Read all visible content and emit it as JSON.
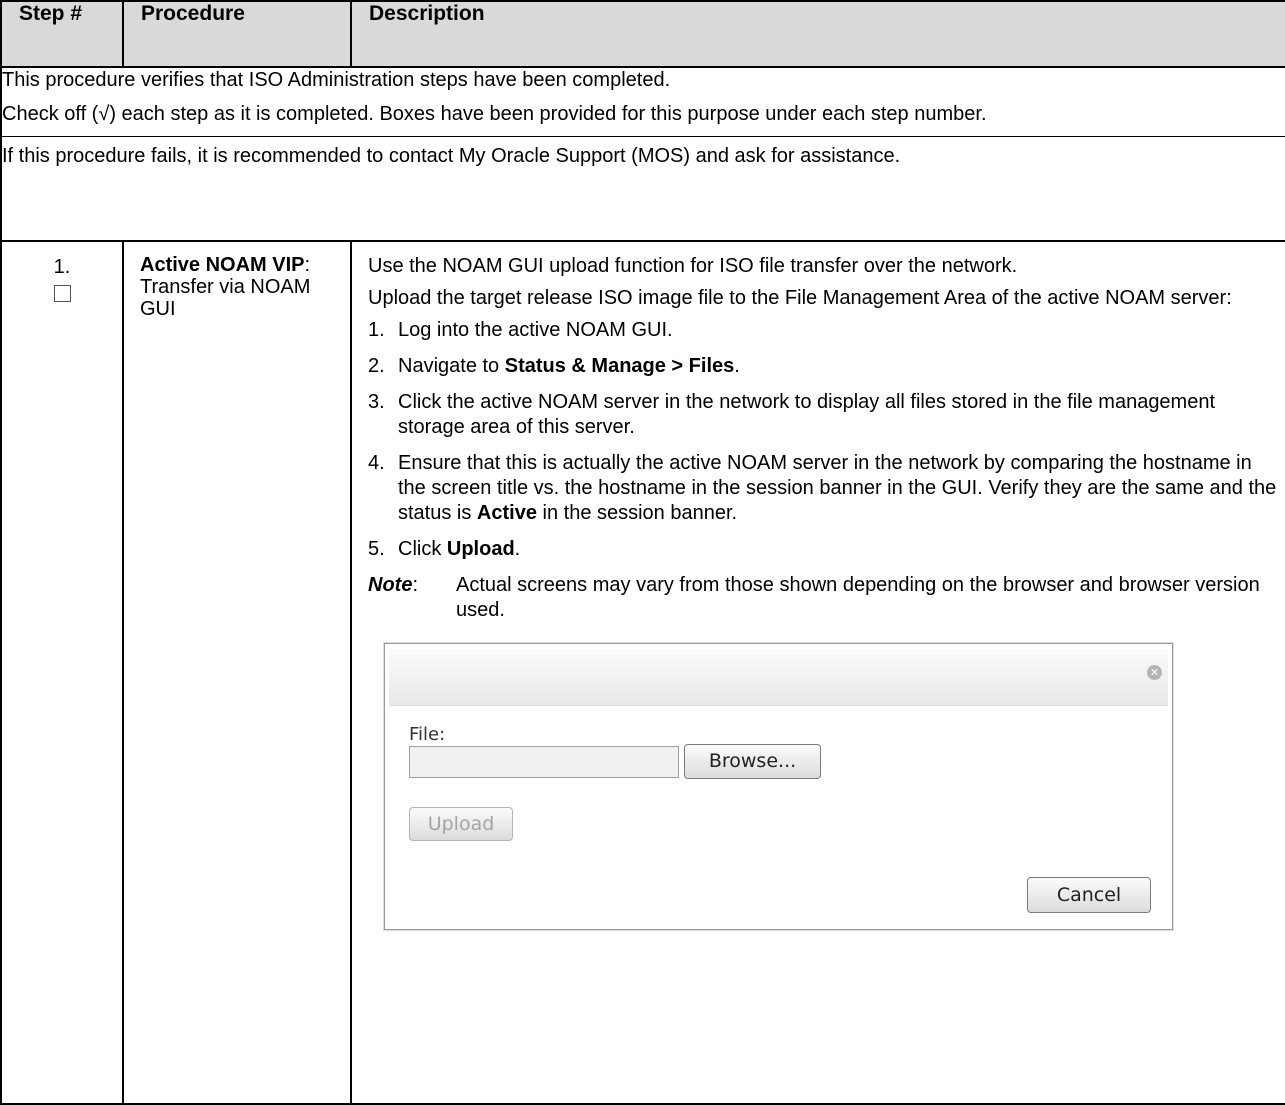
{
  "header": {
    "step": "Step #",
    "procedure": "Procedure",
    "description": "Description"
  },
  "intro": {
    "line1": "This procedure verifies that ISO Administration steps have been completed.",
    "line2": "Check off (√) each step as it is completed.  Boxes have been provided for this purpose under each step number.",
    "line3": "If this procedure fails, it is recommended to contact My Oracle Support (MOS) and ask for assistance."
  },
  "step1": {
    "number": "1.",
    "title_bold": "Active NOAM VIP",
    "title_rest": ":  Transfer via NOAM GUI",
    "para1": "Use the NOAM GUI upload function for ISO file transfer over the network.",
    "para2": "Upload the target release ISO image file to the File Management Area of the active NOAM server:",
    "items": [
      {
        "n": "1.",
        "text": "Log into the active NOAM GUI."
      },
      {
        "n": "2.",
        "pre": "Navigate to ",
        "bold": "Status & Manage > Files",
        "post": "."
      },
      {
        "n": "3.",
        "text": "Click the active NOAM server in the network to display all files stored in the file management storage area of this server."
      },
      {
        "n": "4.",
        "pre": "Ensure that this is actually the active NOAM server in the network by comparing the hostname in the screen title vs. the hostname in the session banner in the GUI. Verify they are the same and the status is ",
        "bold": "Active",
        "post": " in the session banner."
      },
      {
        "n": "5.",
        "pre": "Click ",
        "bold": "Upload",
        "post": "."
      }
    ],
    "note_label": "Note",
    "note_text": "Actual screens may vary from those shown depending on the browser and browser version used."
  },
  "dialog": {
    "file_label": "File:",
    "browse": "Browse...",
    "upload": "Upload",
    "cancel": "Cancel"
  }
}
